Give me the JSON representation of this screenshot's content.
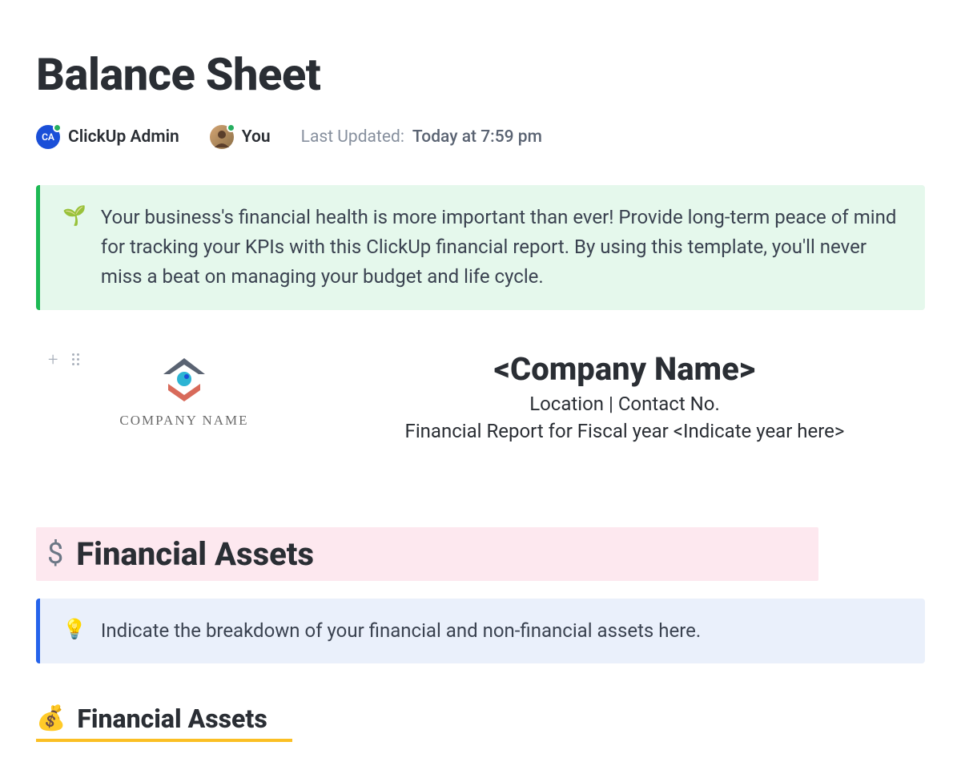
{
  "page": {
    "title": "Balance Sheet"
  },
  "meta": {
    "admin_avatar_text": "CA",
    "admin_name": "ClickUp Admin",
    "you_name": "You",
    "updated_label": "Last Updated:",
    "updated_value": "Today at 7:59 pm"
  },
  "intro_callout": {
    "emoji": "🌱",
    "text": "Your business's financial health is more important than ever! Provide long-term peace of mind for tracking your KPIs with this ClickUp financial report. By using this template, you'll never miss a beat on managing your budget and life cycle."
  },
  "company_header": {
    "logo_caption": "COMPANY NAME",
    "name": "<Company Name>",
    "location_contact": "Location | Contact No.",
    "fiscal_line": "Financial Report for Fiscal year <Indicate year here>"
  },
  "assets_section": {
    "banner_icon": "$",
    "banner_text": "Financial Assets",
    "callout_emoji": "💡",
    "callout_text": "Indicate the breakdown of your financial and non-financial assets here.",
    "sub_emoji": "💰",
    "sub_text": "Financial Assets"
  }
}
